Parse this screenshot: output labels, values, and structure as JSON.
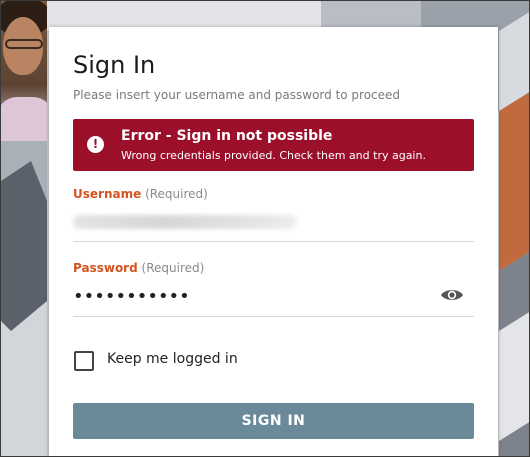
{
  "colors": {
    "accent_label": "#d4531e",
    "error_bg": "#9b0f2a",
    "button_bg": "#6b8a99"
  },
  "signin": {
    "title": "Sign In",
    "subtitle": "Please insert your username and password to proceed"
  },
  "error": {
    "icon": "alert-circle-icon",
    "title": "Error - Sign in not possible",
    "message": "Wrong credentials provided. Check them and try again."
  },
  "username": {
    "label": "Username",
    "required": "(Required)"
  },
  "password": {
    "label": "Password",
    "required": "(Required)",
    "value": "•••••••••••",
    "toggle_icon": "eye-icon"
  },
  "keep_logged_in": {
    "label": "Keep me logged in",
    "checked": false
  },
  "submit": {
    "label": "SIGN IN"
  }
}
